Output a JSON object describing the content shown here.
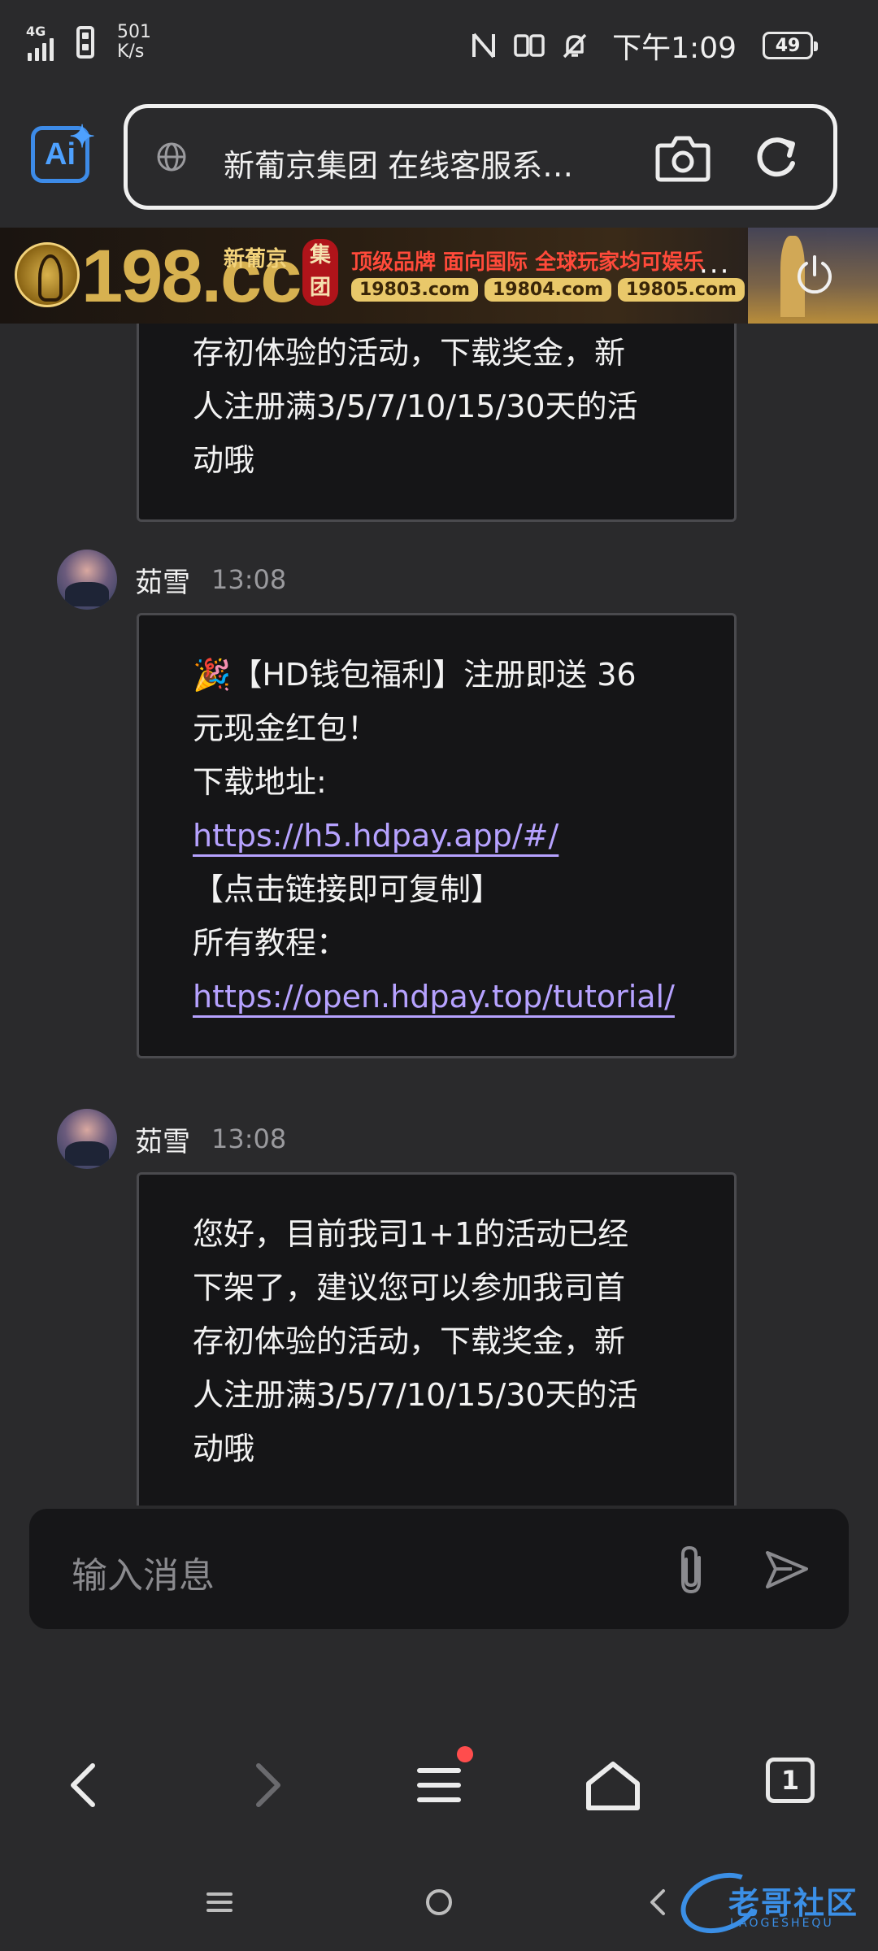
{
  "status_bar": {
    "network": "4G",
    "speed_value": "501",
    "speed_unit": "K/s",
    "time": "下午1:09",
    "battery": "49"
  },
  "browser": {
    "url_title": "新葡京集团 在线客服系…",
    "icons": [
      "ai-assistant-icon",
      "globe-icon",
      "camera-icon",
      "reload-icon"
    ]
  },
  "ad": {
    "domain": "198.cc",
    "brand": "新葡京",
    "seal": "集团",
    "slogan": "顶级品牌 面向国际 全球玩家均可娱乐",
    "domains": [
      "19803.com",
      "19804.com",
      "19805.com"
    ],
    "more": "···"
  },
  "messages": [
    {
      "partial": true,
      "lines": [
        "存初体验的活动，下载奖金，新",
        "人注册满3/5/7/10/15/30天的活",
        "动哦"
      ]
    },
    {
      "sender": "茹雪",
      "time": "13:08",
      "lines": [
        "🎉【HD钱包福利】注册即送 36",
        "元现金红包！",
        "下载地址:"
      ],
      "link1": "https://h5.hdpay.app/#/",
      "lines2": [
        "【点击链接即可复制】",
        "所有教程："
      ],
      "link2": "https://open.hdpay.top/tutorial/"
    },
    {
      "sender": "茹雪",
      "time": "13:08",
      "lines": [
        "您好，目前我司1+1的活动已经",
        "下架了，建议您可以参加我司首",
        "存初体验的活动，下载奖金，新",
        "人注册满3/5/7/10/15/30天的活",
        "动哦"
      ]
    }
  ],
  "input": {
    "placeholder": "输入消息"
  },
  "bottom_nav": {
    "tab_count": "1"
  },
  "watermark": {
    "text": "老哥社区",
    "sub": "LAOGESHEQU"
  },
  "colors": {
    "background": "#2a2a2c",
    "bubble": "#151517",
    "link": "#b6a2ff",
    "accent": "#3d8be8"
  }
}
